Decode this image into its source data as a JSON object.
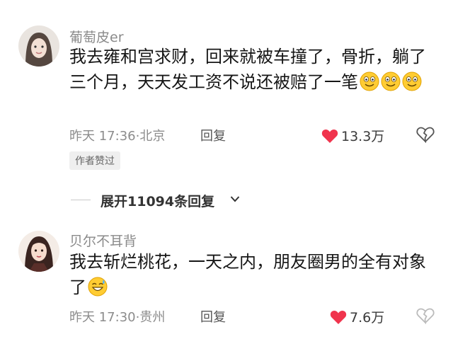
{
  "comments": [
    {
      "username": "葡萄皮er",
      "content": "我去雍和宫求财，回来就被车撞了，骨折，躺了三个月，天天发工资不说还被赔了一笔",
      "emojis": [
        "grin-emoji",
        "grin-emoji",
        "grin-emoji"
      ],
      "time": "昨天 17:36",
      "location": "北京",
      "reply_label": "回复",
      "likes": "13.3万",
      "author_badge": "作者赞过"
    },
    {
      "username": "贝尔不耳背",
      "content": "我去斩烂桃花，一天之内，朋友圈男的全有对象了",
      "emojis": [
        "sweat-smile-emoji"
      ],
      "time": "昨天 17:30",
      "location": "贵州",
      "reply_label": "回复",
      "likes": "7.6万"
    }
  ],
  "expand": {
    "label": "展开11094条回复"
  },
  "colors": {
    "heart": "#f0344d",
    "text": "#161616",
    "meta": "#8c8c8c"
  }
}
